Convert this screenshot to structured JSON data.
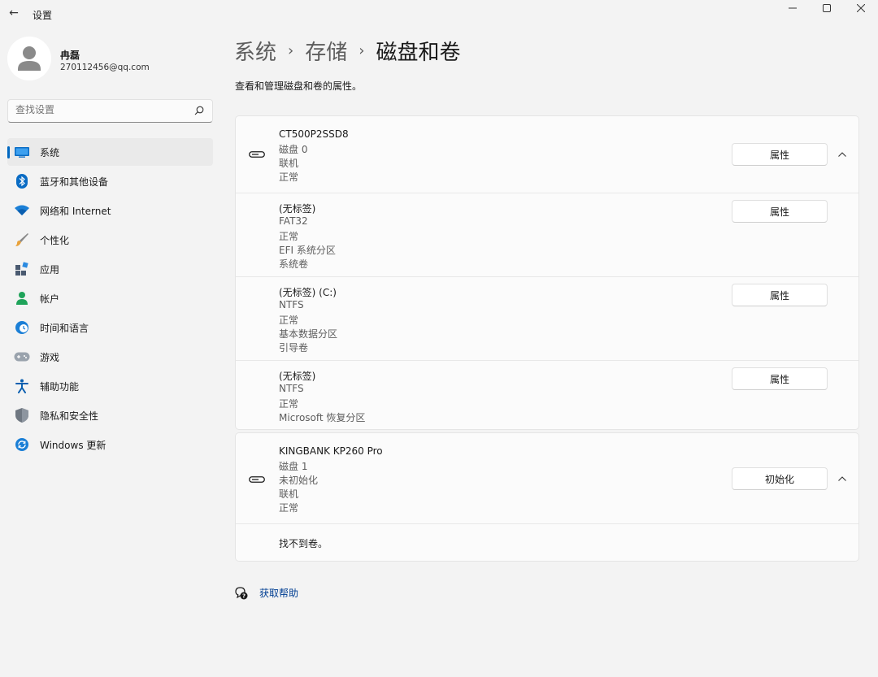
{
  "window": {
    "title": "设置",
    "back_glyph": "←",
    "minimize_glyph": "—",
    "maximize_glyph": "☐",
    "close_glyph": "✕"
  },
  "user": {
    "name": "冉磊",
    "email": "270112456@qq.com"
  },
  "search": {
    "placeholder": "查找设置"
  },
  "nav": {
    "items": [
      {
        "label": "系统",
        "icon": "system-display-icon",
        "active": true
      },
      {
        "label": "蓝牙和其他设备",
        "icon": "bluetooth-icon"
      },
      {
        "label": "网络和 Internet",
        "icon": "wifi-icon"
      },
      {
        "label": "个性化",
        "icon": "brush-icon"
      },
      {
        "label": "应用",
        "icon": "apps-icon"
      },
      {
        "label": "帐户",
        "icon": "account-icon"
      },
      {
        "label": "时间和语言",
        "icon": "globe-clock-icon"
      },
      {
        "label": "游戏",
        "icon": "gamepad-icon"
      },
      {
        "label": "辅助功能",
        "icon": "accessibility-icon"
      },
      {
        "label": "隐私和安全性",
        "icon": "shield-icon"
      },
      {
        "label": "Windows 更新",
        "icon": "update-icon"
      }
    ]
  },
  "header": {
    "breadcrumb": [
      "系统",
      "存储",
      "磁盘和卷"
    ],
    "separator": "›",
    "subtitle": "查看和管理磁盘和卷的属性。"
  },
  "disks": [
    {
      "lines": [
        "CT500P2SSD8",
        "磁盘 0",
        "联机",
        "正常"
      ],
      "button": "属性",
      "volumes": [
        {
          "lines": [
            "(无标签)",
            "FAT32",
            "正常",
            "EFI 系统分区",
            "系统卷"
          ],
          "button": "属性"
        },
        {
          "lines": [
            "(无标签) (C:)",
            "NTFS",
            "正常",
            "基本数据分区",
            "引导卷"
          ],
          "button": "属性"
        },
        {
          "lines": [
            "(无标签)",
            "NTFS",
            "正常",
            "Microsoft 恢复分区"
          ],
          "button": "属性"
        }
      ]
    },
    {
      "lines": [
        "KINGBANK KP260 Pro",
        "磁盘 1",
        "未初始化",
        "联机",
        "正常"
      ],
      "button": "初始化",
      "no_volumes": "找不到卷。"
    }
  ],
  "help": {
    "label": "获取帮助"
  },
  "colors": {
    "accent": "#0067c0",
    "link": "#003e92",
    "background": "#f3f3f3",
    "card": "#fbfbfb"
  }
}
